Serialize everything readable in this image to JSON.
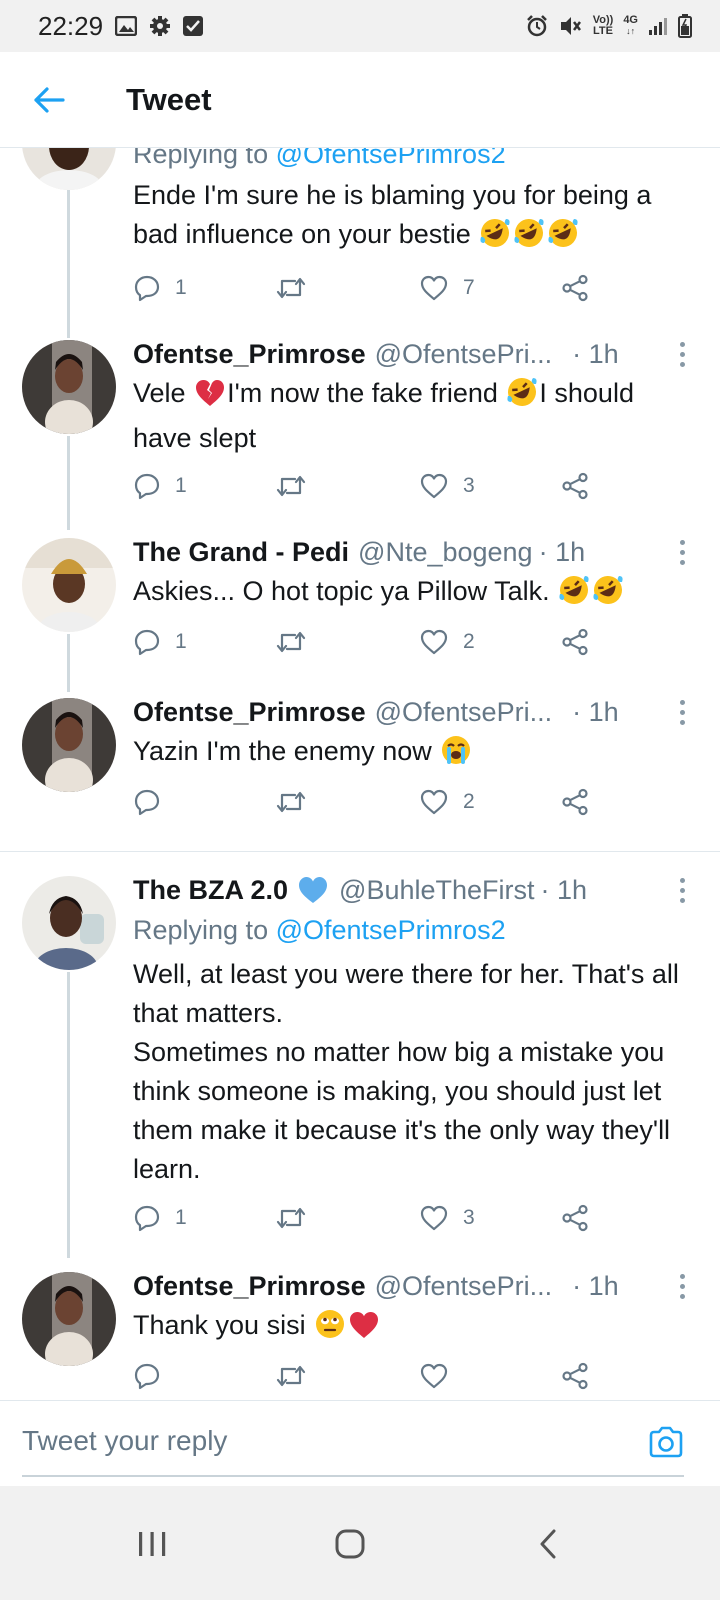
{
  "status_bar": {
    "time": "22:29",
    "left_icons": [
      "image-icon",
      "gear-icon",
      "checkbox-icon"
    ],
    "right_icons": [
      "alarm-icon",
      "mute-icon",
      "volte-icon",
      "4g-icon",
      "signal-icon",
      "battery-icon"
    ],
    "volte_line1": "Vo))",
    "volte_line2": "LTE",
    "net_label": "4G"
  },
  "header": {
    "title": "Tweet"
  },
  "tweets": [
    {
      "replying_label": "Replying to",
      "replying_to": "@OfentsePrimros2",
      "text": "Ende I'm sure he is blaming you for being a bad influence on your bestie",
      "emojis": [
        "rofl",
        "rofl",
        "rofl"
      ],
      "replies": "1",
      "retweets": "",
      "likes": "7"
    },
    {
      "name": "Ofentse_Primrose",
      "handle": "@OfentsePri...",
      "time": "· 1h",
      "text_1": "Vele",
      "text_2": "I'm now the fake friend",
      "text_3": "I should have slept",
      "emojis": [
        "broken-heart",
        "rofl"
      ],
      "replies": "1",
      "retweets": "",
      "likes": "3"
    },
    {
      "name": "The Grand - Pedi",
      "handle": "@Nte_bogeng",
      "time": "· 1h",
      "text": "Askies... O hot topic ya Pillow Talk.",
      "emojis": [
        "rofl",
        "rofl"
      ],
      "replies": "1",
      "retweets": "",
      "likes": "2"
    },
    {
      "name": "Ofentse_Primrose",
      "handle": "@OfentsePri...",
      "time": "· 1h",
      "text": "Yazin I'm the enemy now",
      "emojis": [
        "loudly-crying"
      ],
      "replies": "",
      "retweets": "",
      "likes": "2"
    },
    {
      "name": "The BZA 2.0",
      "verified": true,
      "handle": "@BuhleTheFirst",
      "time": "· 1h",
      "replying_label": "Replying to",
      "replying_to": "@OfentsePrimros2",
      "paragraphs": [
        "Well, at least you were there for her. That's all that matters.",
        "Sometimes no matter how big a mistake you think someone is making, you should just let them make it because it's the only way they'll learn."
      ],
      "replies": "1",
      "retweets": "",
      "likes": "3"
    },
    {
      "name": "Ofentse_Primrose",
      "handle": "@OfentsePri...",
      "time": "· 1h",
      "text": "Thank you sisi",
      "emojis": [
        "face-with-rolling-eyes",
        "red-heart"
      ],
      "replies": "",
      "retweets": "",
      "likes": ""
    }
  ],
  "compose": {
    "placeholder": "Tweet your reply"
  },
  "nav_bar": {
    "buttons": [
      "recents-button",
      "home-button",
      "back-button"
    ]
  },
  "colors": {
    "accent": "#1da1f2",
    "text": "#14171a",
    "secondary_text": "#657786",
    "divider": "#e1e8ed",
    "status_bar_bg": "#f1f1f1"
  }
}
